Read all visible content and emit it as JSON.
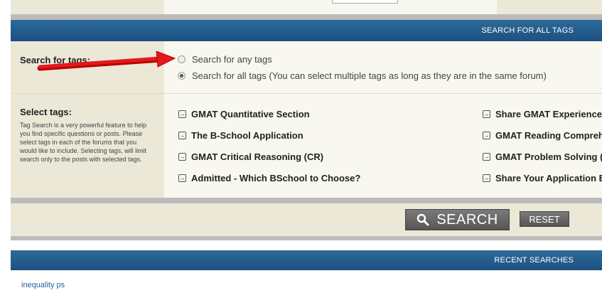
{
  "all_tags_header": "SEARCH FOR ALL TAGS",
  "search_for_tags": {
    "label": "Search for tags:",
    "options": [
      {
        "label": "Search for any tags",
        "checked": false
      },
      {
        "label": "Search for all tags (You can select multiple tags as long as they are in the same forum)",
        "checked": true
      }
    ]
  },
  "select_tags": {
    "label": "Select tags:",
    "description": "Tag Search is a very powerful feature to help you find specific questions or posts. Please select tags in each of the forums that you would like to include. Selecting tags, will limit search only to the posts with selected tags.",
    "left_column": [
      "GMAT Quantitative Section",
      "The B-School Application",
      "GMAT Critical Reasoning (CR)",
      "Admitted - Which BSchool to Choose?"
    ],
    "right_column": [
      "Share GMAT Experience",
      "GMAT Reading Comprehe",
      "GMAT Problem Solving (",
      "Share Your Application E"
    ],
    "tag_icon": "arrow-right-box-icon"
  },
  "buttons": {
    "search": "SEARCH",
    "reset": "RESET"
  },
  "recent_header": "RECENT SEARCHES",
  "recent_searches": [
    "inequality ps"
  ],
  "colors": {
    "header_blue": "#1d5080",
    "label_bg": "#ebe8d8",
    "body_bg": "#f8f7f0",
    "arrow_red": "#e3191c",
    "link_blue": "#2a5fa0"
  }
}
